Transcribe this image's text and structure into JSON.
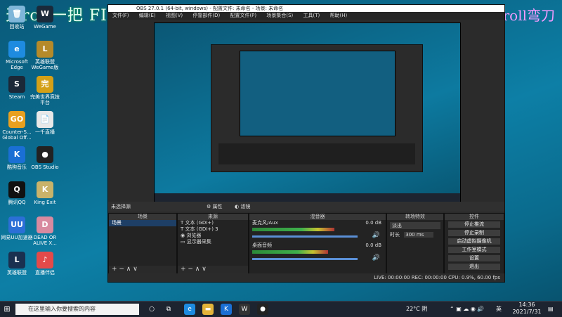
{
  "overlay": {
    "title": "天roll一把 FIMAC 无忌峰",
    "right": "五十粉roll弯刀"
  },
  "desktop_icons": [
    {
      "label": "回收站",
      "color": "#7fb6d9",
      "glyph": "🗑"
    },
    {
      "label": "WeGame",
      "color": "#1a2a3a",
      "glyph": "W"
    },
    {
      "label": "Microsoft Edge",
      "color": "#1e8be0",
      "glyph": "e"
    },
    {
      "label": "英雄联盟WeGame版",
      "color": "#b58a2a",
      "glyph": "L"
    },
    {
      "label": "Steam",
      "color": "#1b2838",
      "glyph": "S"
    },
    {
      "label": "完美世界竞技平台",
      "color": "#d4a017",
      "glyph": "完"
    },
    {
      "label": "Counter-S... Global Off...",
      "color": "#e8a020",
      "glyph": "GO"
    },
    {
      "label": "一千直播",
      "color": "#e8e8e8",
      "glyph": "📄"
    },
    {
      "label": "酷狗音乐",
      "color": "#1a6fd4",
      "glyph": "K"
    },
    {
      "label": "OBS Studio",
      "color": "#222",
      "glyph": "●"
    },
    {
      "label": "腾讯QQ",
      "color": "#111",
      "glyph": "Q"
    },
    {
      "label": "King Exit",
      "color": "#c9b36a",
      "glyph": "K"
    },
    {
      "label": "网易UU加速器",
      "color": "#2b6fd6",
      "glyph": "UU"
    },
    {
      "label": "DEAD OR ALIVE X...",
      "color": "#d88aa0",
      "glyph": "D"
    },
    {
      "label": "英雄联盟",
      "color": "#1a3050",
      "glyph": "L"
    },
    {
      "label": "直播伴侣",
      "color": "#e24a4a",
      "glyph": "♪"
    }
  ],
  "obs": {
    "window_title": "OBS 27.0.1 (64-bit, windows) - 配置文件: 未命名 - 场景: 未命名",
    "menu": [
      "文件(F)",
      "编辑(E)",
      "视图(V)",
      "停靠部件(D)",
      "配置文件(P)",
      "场景集合(S)",
      "工具(T)",
      "帮助(H)"
    ],
    "status_left": "未选择源",
    "props_btn": "属性",
    "filters_btn": "滤镜",
    "scenes": {
      "title": "场景",
      "items": [
        "场景"
      ]
    },
    "sources": {
      "title": "来源",
      "items": [
        "文本 (GDI+)",
        "文本 (GDI+) 3",
        "浏览器",
        "显示器采集"
      ]
    },
    "mixer": {
      "title": "混音器",
      "tracks": [
        {
          "name": "麦克风/Aux",
          "db": "0.0 dB",
          "level": 0.78
        },
        {
          "name": "桌面音频",
          "db": "0.0 dB",
          "level": 0.72
        }
      ]
    },
    "transitions": {
      "title": "转场特效",
      "type": "淡出",
      "duration_label": "时长",
      "duration": "300 ms"
    },
    "controls": {
      "title": "控件",
      "buttons": [
        "停止推流",
        "停止录制",
        "启动虚拟摄像机",
        "工作室模式",
        "设置",
        "退出"
      ]
    },
    "status_bar": "LIVE: 00:00:00   REC: 00:00:00   CPU: 0.9%, 60.00 fps",
    "foot_symbols": "+ − ∧ ∨"
  },
  "taskbar": {
    "search_placeholder": "在这里输入你要搜索的内容",
    "weather": "22°C 阴",
    "ime": "英",
    "time": "14:36",
    "date": "2021/7/31"
  }
}
